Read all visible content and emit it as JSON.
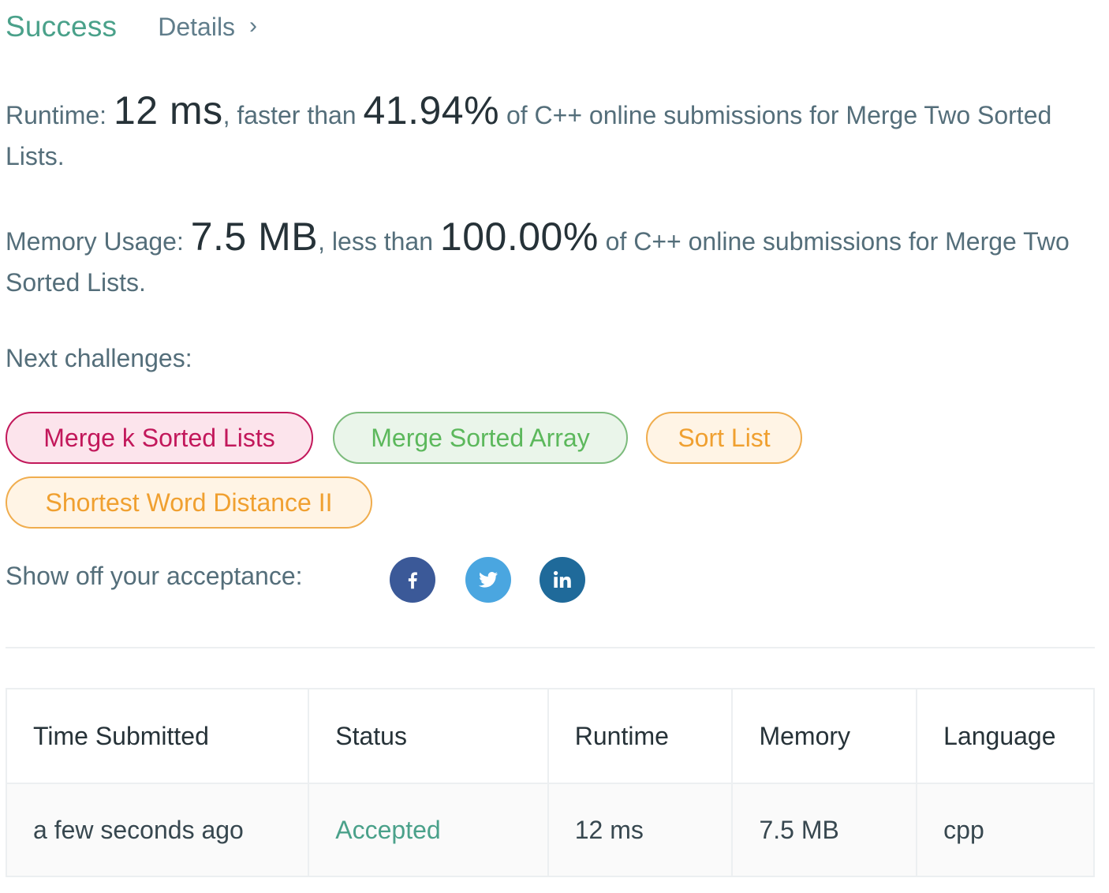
{
  "header": {
    "status": "Success",
    "details_label": "Details",
    "details_chevron": "›"
  },
  "runtime": {
    "label": "Runtime:",
    "value": "12 ms",
    "mid_text": ", faster than",
    "percentile": "41.94%",
    "suffix": "of C++ online submissions for Merge Two Sorted Lists."
  },
  "memory": {
    "label": "Memory Usage:",
    "value": "7.5 MB",
    "mid_text": ", less than",
    "percentile": "100.00%",
    "suffix": "of C++ online submissions for Merge Two Sorted Lists."
  },
  "next_challenges": {
    "label": "Next challenges:",
    "items": [
      {
        "label": "Merge k Sorted Lists",
        "difficulty": "hard"
      },
      {
        "label": "Merge Sorted Array",
        "difficulty": "easy"
      },
      {
        "label": "Sort List",
        "difficulty": "medium"
      },
      {
        "label": "Shortest Word Distance II",
        "difficulty": "medium"
      }
    ]
  },
  "share": {
    "label": "Show off your acceptance:",
    "icons": [
      "facebook-icon",
      "twitter-icon",
      "linkedin-icon"
    ]
  },
  "colors": {
    "success": "#4aa18a",
    "hard": "#c2185b",
    "easy": "#5cb85c",
    "medium": "#f0ad4e",
    "facebook": "#3b5998",
    "twitter": "#4aa6e0",
    "linkedin": "#1f6a9a"
  },
  "table": {
    "headers": [
      "Time Submitted",
      "Status",
      "Runtime",
      "Memory",
      "Language"
    ],
    "rows": [
      [
        "a few seconds ago",
        "Accepted",
        "12 ms",
        "7.5 MB",
        "cpp"
      ]
    ]
  }
}
